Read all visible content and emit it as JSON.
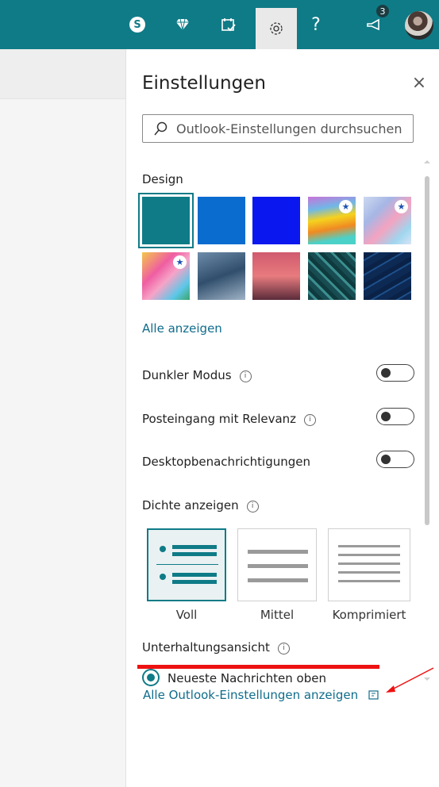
{
  "topbar": {
    "icons": [
      "skype-icon",
      "diamond-icon",
      "calendar-check-icon",
      "gear-icon",
      "help-icon",
      "megaphone-icon",
      "avatar"
    ],
    "help_glyph": "?",
    "skype_glyph": "S",
    "notification_count": "3"
  },
  "settings": {
    "title": "Einstellungen",
    "close_glyph": "×",
    "search_placeholder": "Outlook-Einstellungen durchsuchen",
    "design_label": "Design",
    "show_all_link": "Alle anzeigen",
    "dark_mode_label": "Dunkler Modus",
    "focused_inbox_label": "Posteingang mit Relevanz",
    "desktop_notifications_label": "Desktopbenachrichtigungen",
    "density_label": "Dichte anzeigen",
    "density_options": [
      "Voll",
      "Mittel",
      "Komprimiert"
    ],
    "conversation_label": "Unterhaltungsansicht",
    "conversation_option": "Neueste Nachrichten oben",
    "all_settings_link": "Alle Outlook-Einstellungen anzeigen",
    "toggles": {
      "dark_mode": false,
      "focused_inbox": false,
      "desktop_notifications": false
    },
    "selected_density": "Voll"
  },
  "colors": {
    "accent": "#0f7b87",
    "link": "#0f6c8b",
    "annotation": "#ee1111"
  }
}
